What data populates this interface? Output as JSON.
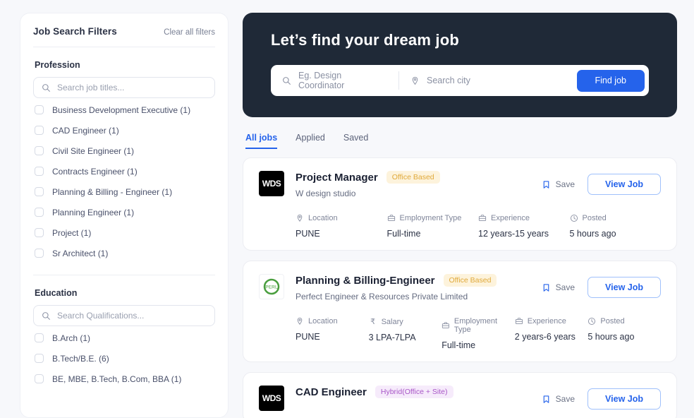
{
  "sidebar": {
    "title": "Job Search Filters",
    "clear_label": "Clear all filters",
    "profession": {
      "heading": "Profession",
      "search_placeholder": "Search job titles...",
      "options": [
        {
          "label": "Business Development Executive (1)"
        },
        {
          "label": "CAD Engineer (1)"
        },
        {
          "label": "Civil Site Engineer (1)"
        },
        {
          "label": "Contracts Engineer (1)"
        },
        {
          "label": "Planning & Billing - Engineer (1)"
        },
        {
          "label": "Planning Engineer (1)"
        },
        {
          "label": "Project (1)"
        },
        {
          "label": "Sr Architect (1)"
        }
      ]
    },
    "education": {
      "heading": "Education",
      "search_placeholder": "Search Qualifications...",
      "options": [
        {
          "label": "B.Arch (1)"
        },
        {
          "label": "B.Tech/B.E. (6)"
        },
        {
          "label": "BE, MBE, B.Tech, B.Com, BBA (1)"
        }
      ]
    }
  },
  "hero": {
    "heading": "Let’s find your dream job",
    "job_placeholder": "Eg. Design Coordinator",
    "city_placeholder": "Search city",
    "find_label": "Find job",
    "background": "#1f2937",
    "accent": "#2563eb"
  },
  "tabs": [
    {
      "label": "All jobs",
      "active": true
    },
    {
      "label": "Applied",
      "active": false
    },
    {
      "label": "Saved",
      "active": false
    }
  ],
  "cards": [
    {
      "logo_text": "WDS",
      "logo_style": "dark",
      "title": "Project Manager",
      "badge": "Office Based",
      "badge_style": "office",
      "company": "W design studio",
      "save_label": "Save",
      "view_label": "View Job",
      "meta": [
        {
          "icon": "location-pin-icon",
          "label": "Location",
          "value": "PUNE"
        },
        {
          "icon": "briefcase-icon",
          "label": "Employment Type",
          "value": "Full-time"
        },
        {
          "icon": "briefcase-icon",
          "label": "Experience",
          "value": "12 years-15 years"
        },
        {
          "icon": "clock-icon",
          "label": "Posted",
          "value": "5 hours ago"
        }
      ]
    },
    {
      "logo_text": "PERL",
      "logo_style": "light",
      "title": "Planning & Billing-Engineer",
      "badge": "Office Based",
      "badge_style": "office",
      "company": "Perfect Engineer & Resources Private Limited",
      "save_label": "Save",
      "view_label": "View Job",
      "meta": [
        {
          "icon": "location-pin-icon",
          "label": "Location",
          "value": "PUNE"
        },
        {
          "icon": "rupee-icon",
          "label": "Salary",
          "value": "3 LPA-7LPA"
        },
        {
          "icon": "briefcase-icon",
          "label": "Employment Type",
          "value": "Full-time"
        },
        {
          "icon": "briefcase-icon",
          "label": "Experience",
          "value": "2 years-6 years"
        },
        {
          "icon": "clock-icon",
          "label": "Posted",
          "value": "5 hours ago"
        }
      ]
    },
    {
      "logo_text": "WDS",
      "logo_style": "dark",
      "title": "CAD Engineer",
      "badge": "Hybrid(Office + Site)",
      "badge_style": "hybrid",
      "company": "",
      "save_label": "Save",
      "view_label": "View Job",
      "meta": []
    }
  ]
}
